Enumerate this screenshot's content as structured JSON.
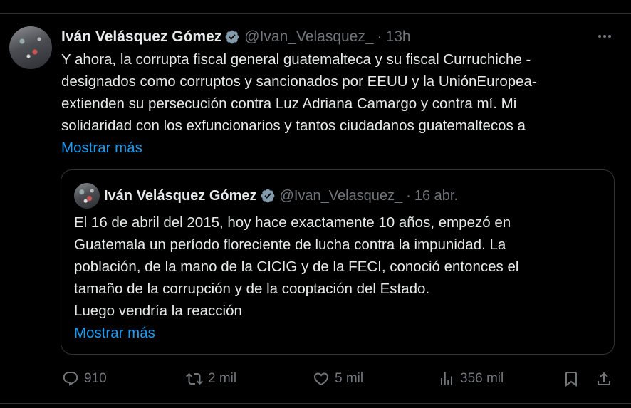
{
  "post": {
    "author_name": "Iván Velásquez Gómez",
    "handle": "@Ivan_Velasquez_",
    "separator": "·",
    "time": "13h",
    "text_lines": [
      "Y ahora, la corrupta fiscal general guatemalteca y su fiscal Curruchiche -",
      "designados como corruptos y sancionados por EEUU y la UniónEuropea-",
      "extienden su persecución contra Luz Adriana Camargo y contra mí. Mi",
      "solidaridad con los exfuncionarios y tantos ciudadanos guatemaltecos a"
    ],
    "show_more": "Mostrar más"
  },
  "quote": {
    "author_name": "Iván Velásquez Gómez",
    "handle": "@Ivan_Velasquez_",
    "separator": "·",
    "time": "16 abr.",
    "text_lines": [
      "El 16 de abril del 2015, hoy hace exactamente 10 años, empezó en",
      "Guatemala un período floreciente de lucha contra la impunidad. La",
      "población, de la mano de la CICIG y de la FECI, conoció entonces el",
      "tamaño de la corrupción y de la cooptación del Estado.",
      "Luego vendría la reacción"
    ],
    "show_more": "Mostrar más"
  },
  "actions": {
    "replies": "910",
    "reposts": "2 mil",
    "likes": "5 mil",
    "views": "356 mil"
  },
  "icons": [
    "verified-badge-icon",
    "more-icon",
    "reply-icon",
    "repost-icon",
    "like-icon",
    "views-icon",
    "bookmark-icon",
    "share-icon"
  ],
  "colors": {
    "background": "#000000",
    "text": "#e7e9ea",
    "muted": "#71767b",
    "link": "#1d9bf0",
    "verified": "#829aab",
    "border": "#2f3336"
  }
}
